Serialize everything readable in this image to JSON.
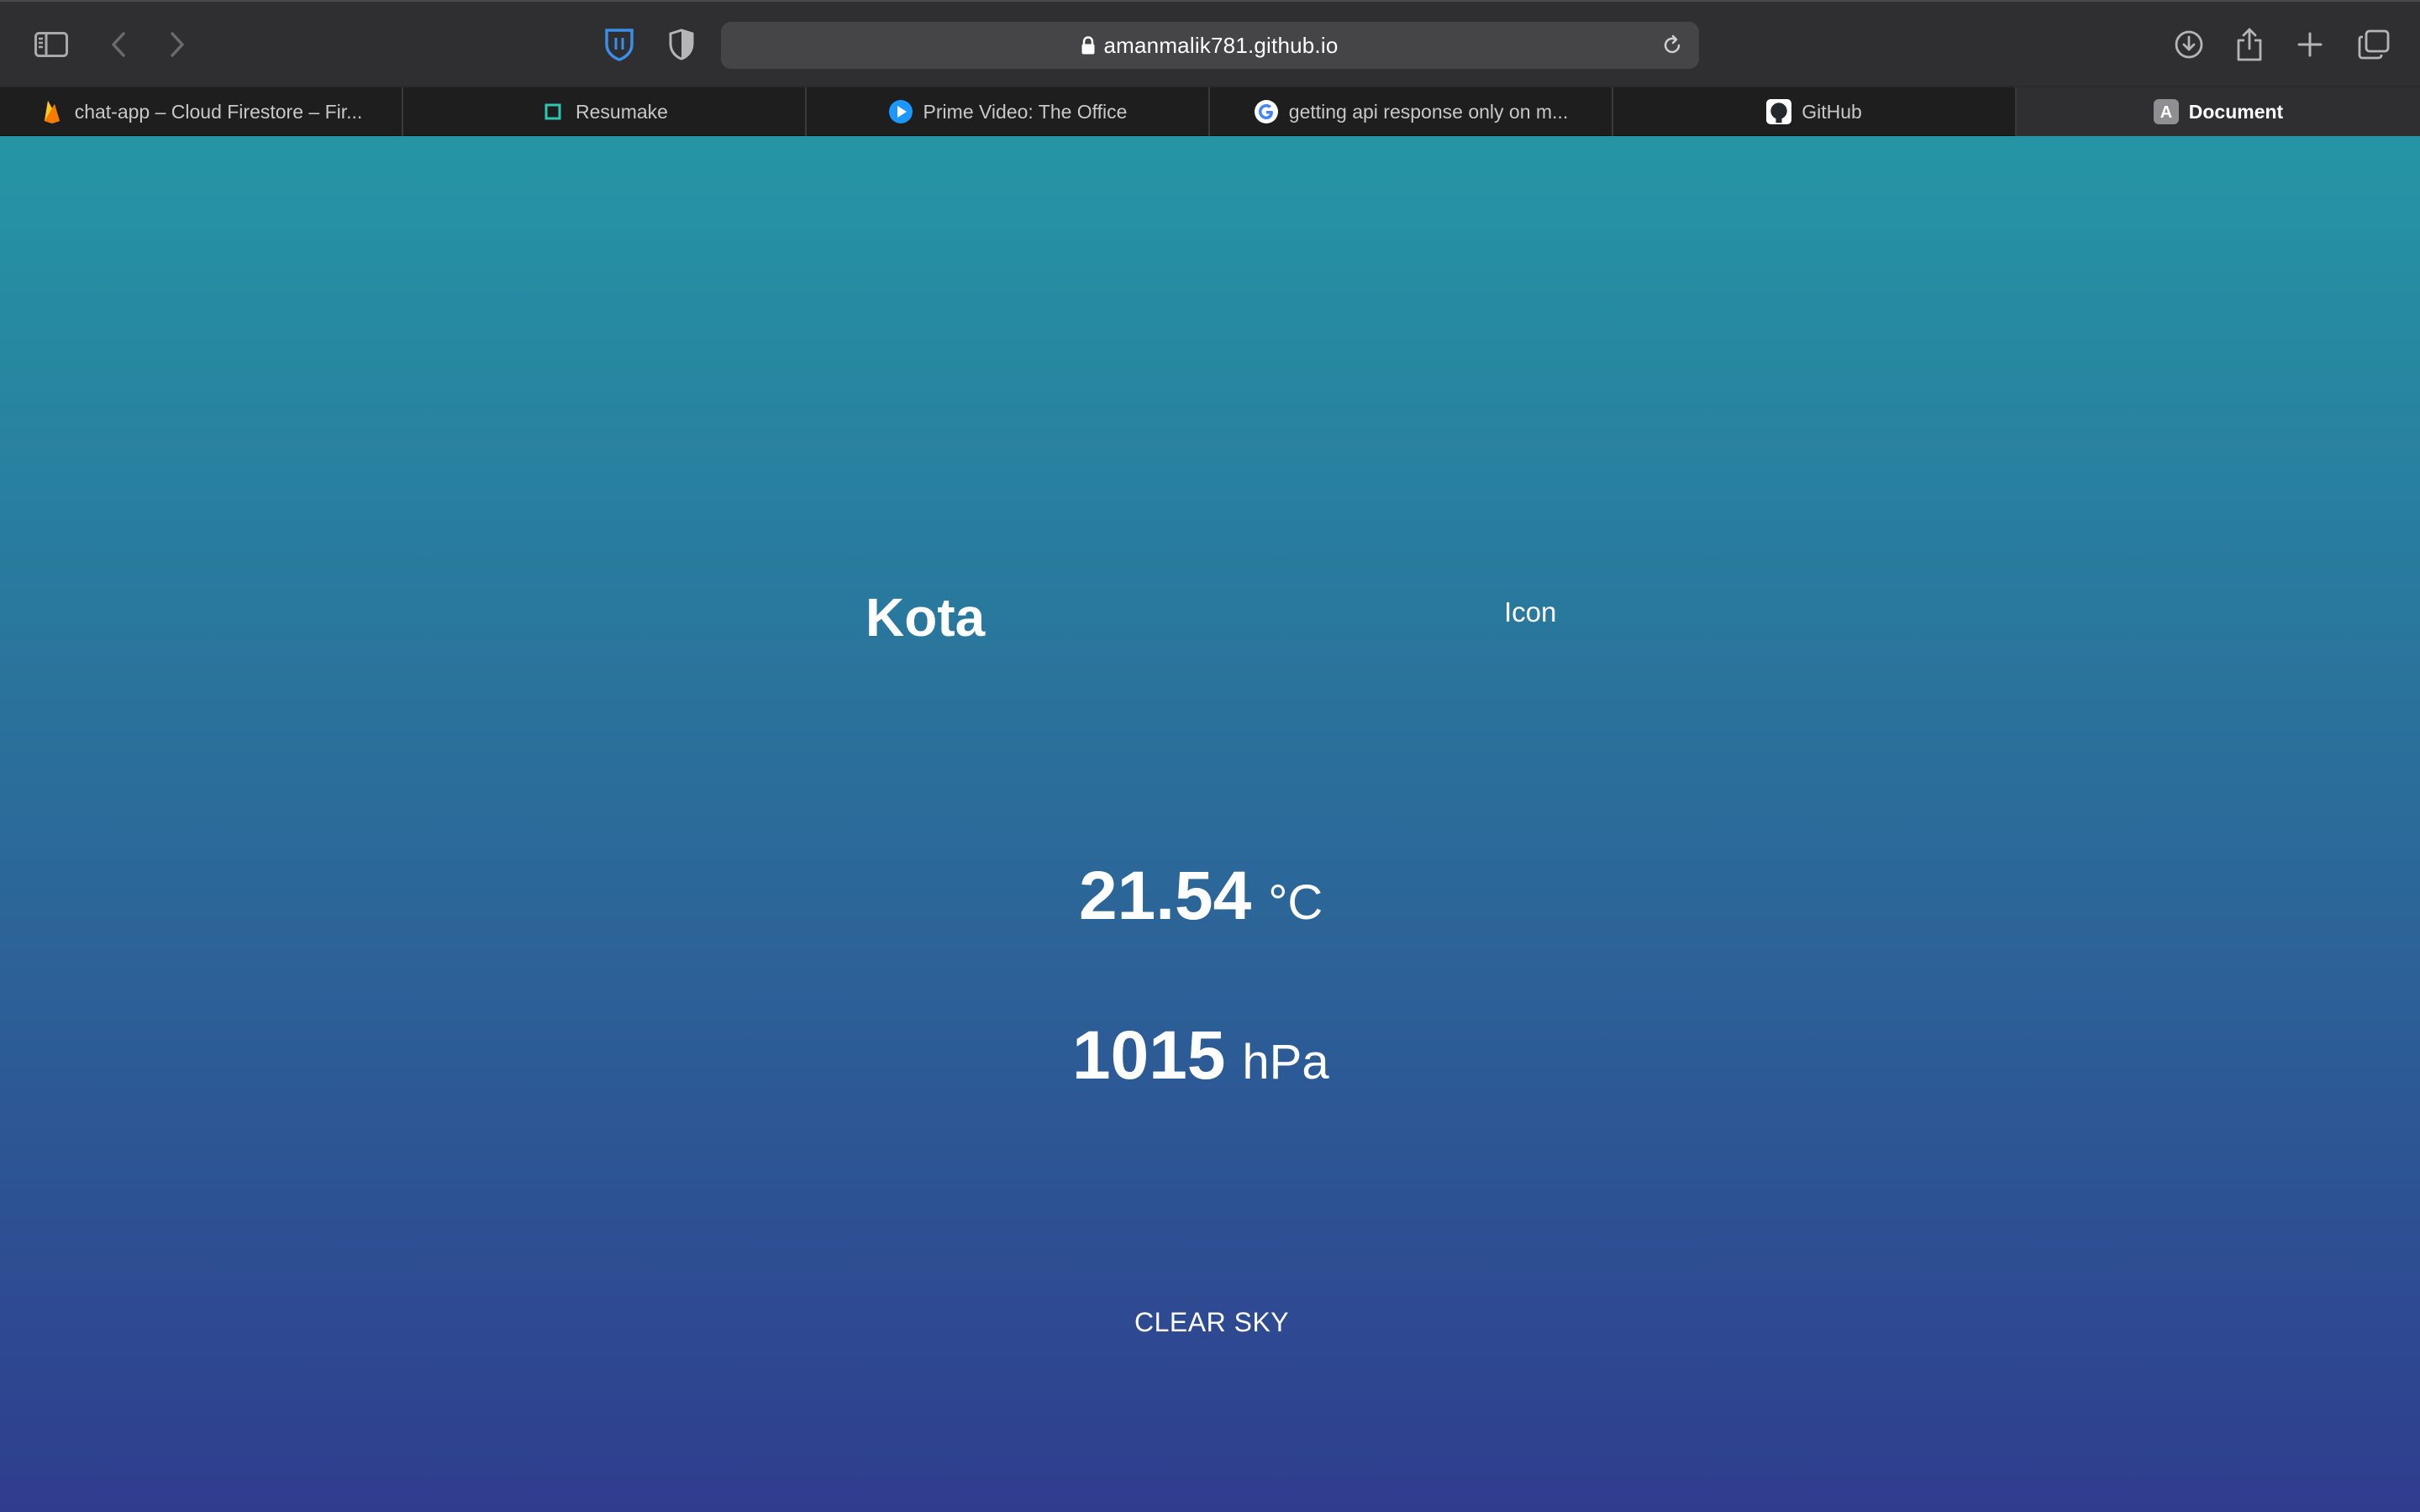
{
  "browser": {
    "url": "amanmalik781.github.io",
    "tabs": [
      {
        "label": "chat-app – Cloud Firestore – Fir...",
        "favicon": "firebase-icon"
      },
      {
        "label": "Resumake",
        "favicon": "resumake-icon"
      },
      {
        "label": "Prime Video: The Office",
        "favicon": "prime-video-icon"
      },
      {
        "label": "getting api response only on m...",
        "favicon": "google-icon"
      },
      {
        "label": "GitHub",
        "favicon": "github-icon"
      },
      {
        "label": "Document",
        "favicon": "letter-a-icon",
        "avatar_letter": "A",
        "active": true
      }
    ]
  },
  "weather": {
    "city": "Kota",
    "icon_label": "Icon",
    "temperature": "21.54",
    "temperature_unit": "°C",
    "pressure": "1015",
    "pressure_unit": "hPa",
    "description": "CLEAR SKY"
  },
  "colors": {
    "gradient_top": "#2595a5",
    "gradient_bottom": "#2f3d8e",
    "toolbar": "#2f2e31",
    "tabstrip": "#1e1e1f"
  }
}
